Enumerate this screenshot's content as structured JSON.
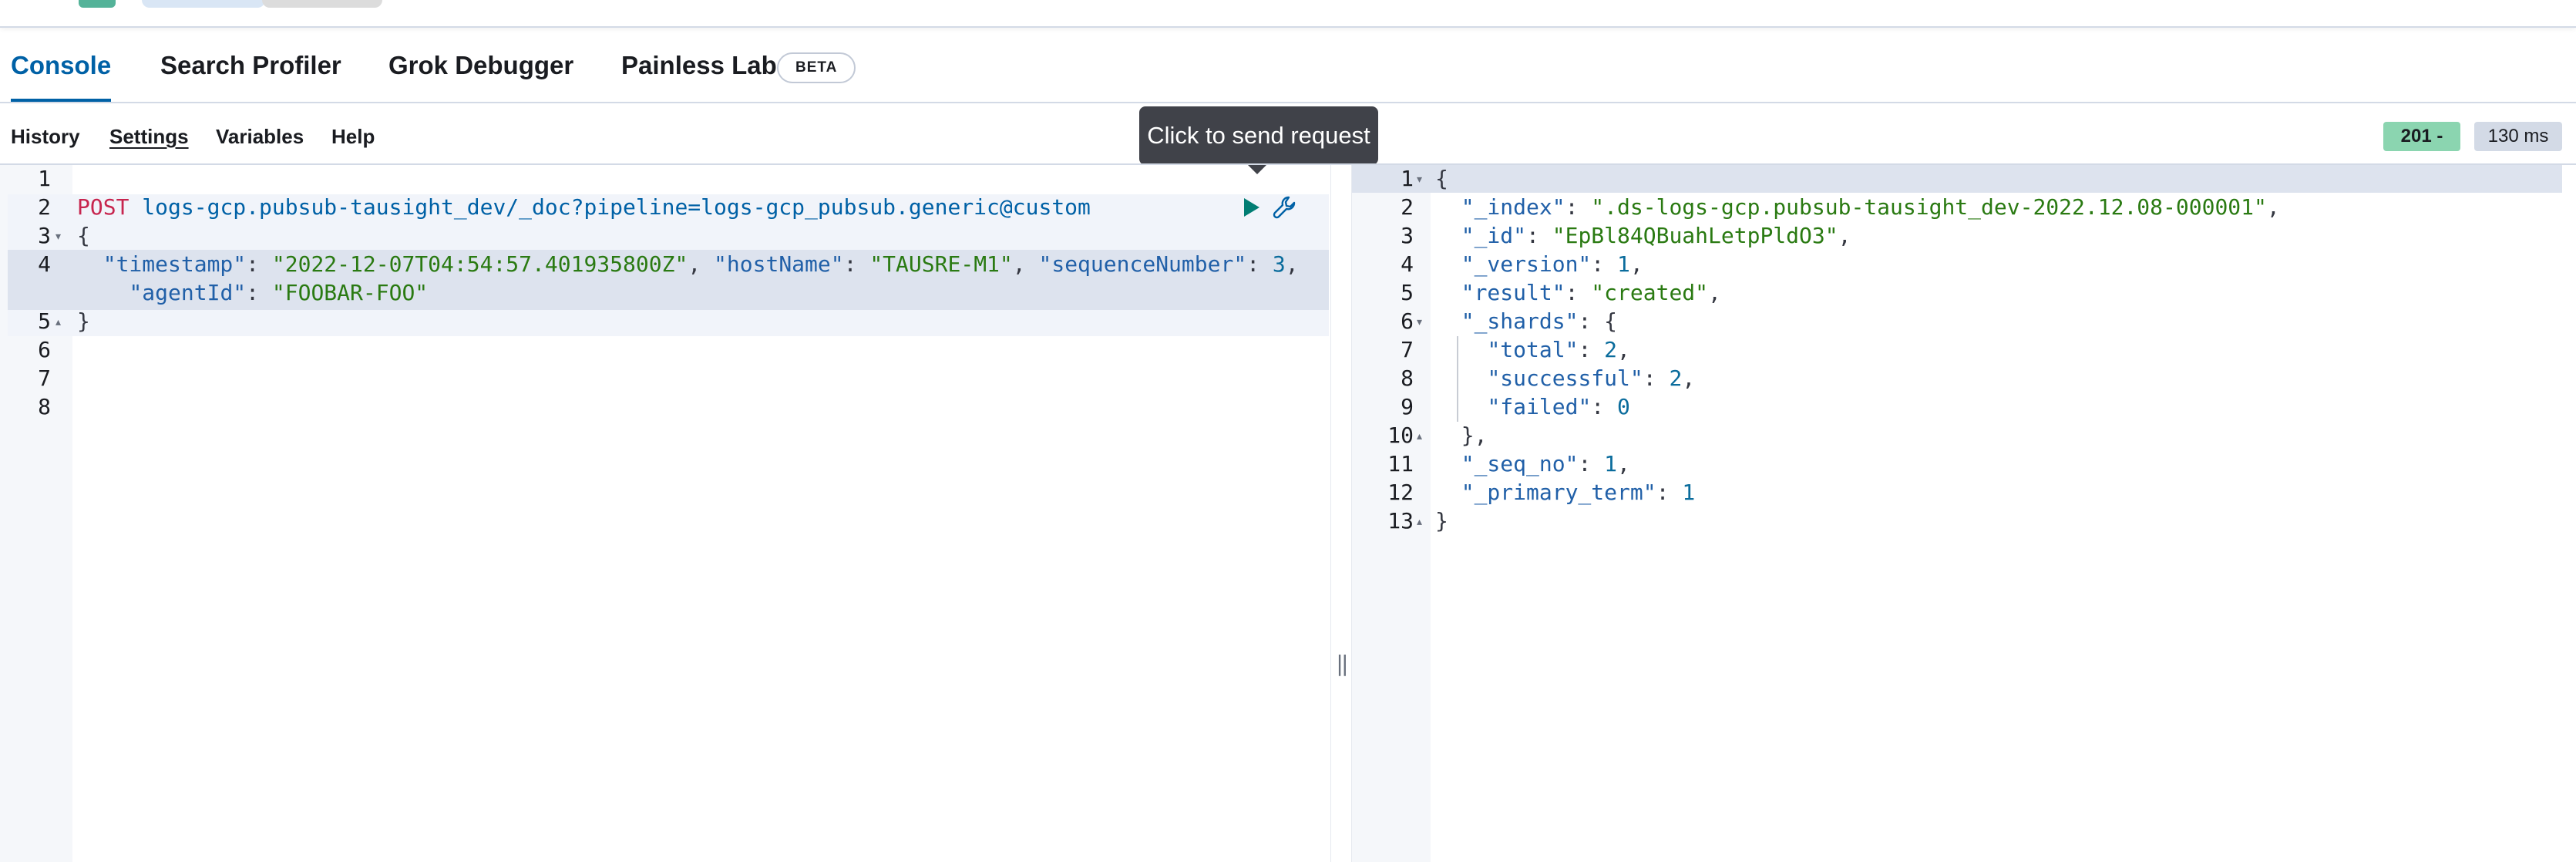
{
  "tabs": [
    {
      "label": "Console"
    },
    {
      "label": "Search Profiler"
    },
    {
      "label": "Grok Debugger"
    },
    {
      "label": "Painless Lab"
    }
  ],
  "beta_badge": "BETA",
  "toolbar": {
    "history": "History",
    "settings": "Settings",
    "variables": "Variables",
    "help": "Help"
  },
  "tooltip": "Click to send request",
  "response_status": {
    "code": "201 -",
    "time": "130 ms",
    "color": "#8bd5b0"
  },
  "request_editor": {
    "line_numbers": [
      "1",
      "2",
      "3",
      "4",
      "",
      "5",
      "6",
      "7",
      "8"
    ],
    "method": "POST",
    "path": "logs-gcp.pubsub-tausight_dev/_doc?pipeline=logs-gcp_pubsub.generic@custom",
    "open_brace": "{",
    "close_brace": "}",
    "fields": [
      {
        "key": "\"timestamp\"",
        "value": "\"2022-12-07T04:54:57.401935800Z\""
      },
      {
        "key": "\"hostName\"",
        "value": "\"TAUSRE-M1\""
      },
      {
        "key": "\"sequenceNumber\"",
        "value": "3"
      },
      {
        "key": "\"agentId\"",
        "value": "\"FOOBAR-FOO\""
      }
    ]
  },
  "response_editor": {
    "line_numbers": [
      "1",
      "2",
      "3",
      "4",
      "5",
      "6",
      "7",
      "8",
      "9",
      "10",
      "11",
      "12",
      "13"
    ],
    "open_brace": "{",
    "close_brace": "}",
    "index_key": "\"_index\"",
    "index_value": "\".ds-logs-gcp.pubsub-tausight_dev-2022.12.08-000001\"",
    "id_key": "\"_id\"",
    "id_value": "\"EpBl84QBuahLetpPldO3\"",
    "version_key": "\"_version\"",
    "version_value": "1",
    "result_key": "\"result\"",
    "result_value": "\"created\"",
    "shards_key": "\"_shards\"",
    "total_key": "\"total\"",
    "total_value": "2",
    "successful_key": "\"successful\"",
    "successful_value": "2",
    "failed_key": "\"failed\"",
    "failed_value": "0",
    "shards_close": "},",
    "seq_no_key": "\"_seq_no\"",
    "seq_no_value": "1",
    "primary_term_key": "\"_primary_term\"",
    "primary_term_value": "1"
  }
}
